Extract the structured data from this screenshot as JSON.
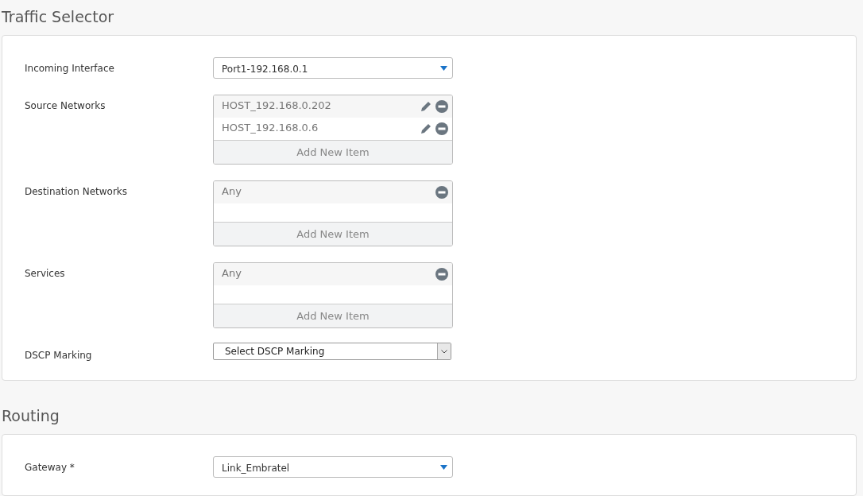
{
  "sections": [
    {
      "title": "Traffic Selector",
      "fields": [
        {
          "kind": "dropdown",
          "label": "Incoming Interface",
          "value": "Port1-192.168.0.1"
        },
        {
          "kind": "list",
          "label": "Source Networks",
          "items": [
            {
              "text": "HOST_192.168.0.202",
              "editable": true
            },
            {
              "text": "HOST_192.168.0.6",
              "editable": true
            }
          ],
          "add_label": "Add New Item"
        },
        {
          "kind": "list",
          "label": "Destination Networks",
          "items": [
            {
              "text": "Any",
              "editable": false
            }
          ],
          "add_label": "Add New Item"
        },
        {
          "kind": "list",
          "label": "Services",
          "items": [
            {
              "text": "Any",
              "editable": false
            }
          ],
          "add_label": "Add New Item"
        },
        {
          "kind": "select",
          "label": "DSCP Marking",
          "value": "Select DSCP Marking"
        }
      ]
    },
    {
      "title": "Routing",
      "fields": [
        {
          "kind": "dropdown",
          "label": "Gateway *",
          "value": "Link_Embratel"
        }
      ]
    }
  ]
}
